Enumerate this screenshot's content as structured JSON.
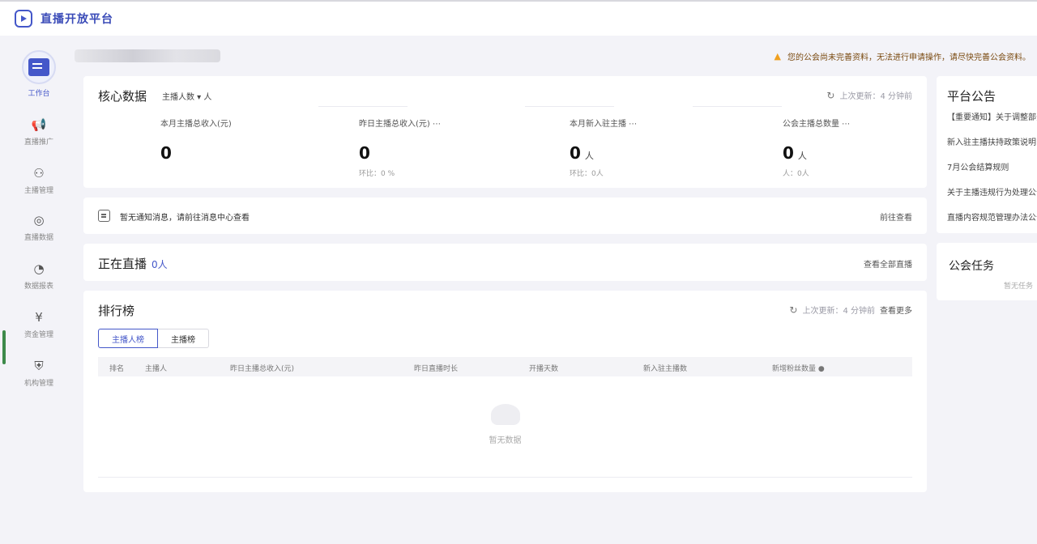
{
  "app": {
    "title": "直播开放平台"
  },
  "sidebar": {
    "items": [
      {
        "label": "工作台",
        "icon": "monitor-icon"
      },
      {
        "label": "直播推广",
        "icon": "megaphone-icon"
      },
      {
        "label": "主播管理",
        "icon": "user-manage-icon"
      },
      {
        "label": "直播数据",
        "icon": "chart-circle-icon"
      },
      {
        "label": "数据报表",
        "icon": "pie-chart-icon"
      },
      {
        "label": "资金管理",
        "icon": "money-icon"
      },
      {
        "label": "机构管理",
        "icon": "shield-icon"
      }
    ]
  },
  "header": {
    "notice": "您的公会尚未完善资料，无法进行申请操作，请尽快完善公会资料。"
  },
  "core": {
    "title": "核心数据",
    "filter": "主播人数 ▾ 人",
    "refresh": "上次更新：4 分钟前",
    "metrics": [
      {
        "label": "本月主播总收入(元)",
        "value": "0",
        "unit": "",
        "sub": ""
      },
      {
        "label": "昨日主播总收入(元) ⋯",
        "value": "0",
        "unit": "",
        "sub": "环比：0 %"
      },
      {
        "label": "本月新入驻主播 ⋯",
        "value": "0",
        "unit": "人",
        "sub": "环比：0人"
      },
      {
        "label": "公会主播总数量 ⋯",
        "value": "0",
        "unit": "人",
        "sub": "人：0人"
      }
    ]
  },
  "hint": {
    "text": "暂无通知消息，请前往消息中心查看",
    "link": "前往查看"
  },
  "live": {
    "title": "正在直播",
    "count": "0人",
    "link": "查看全部直播"
  },
  "rank": {
    "title": "排行榜",
    "refresh": "上次更新：4 分钟前",
    "refresh_link": "查看更多",
    "tabs": [
      "主播人榜",
      "主播榜"
    ],
    "columns": [
      "排名",
      "主播人",
      "昨日主播总收入(元)",
      "昨日直播时长",
      "开播天数",
      "新入驻主播数",
      "新增粉丝数量 ●"
    ],
    "empty": "暂无数据"
  },
  "notices": {
    "title": "平台公告",
    "items": [
      "【重要通知】关于调整部分...",
      "新入驻主播扶持政策说明",
      "7月公会结算规则",
      "关于主播违规行为处理公告",
      "直播内容规范管理办法公告"
    ]
  },
  "tasks": {
    "title": "公会任务",
    "sub": "暂无任务"
  }
}
